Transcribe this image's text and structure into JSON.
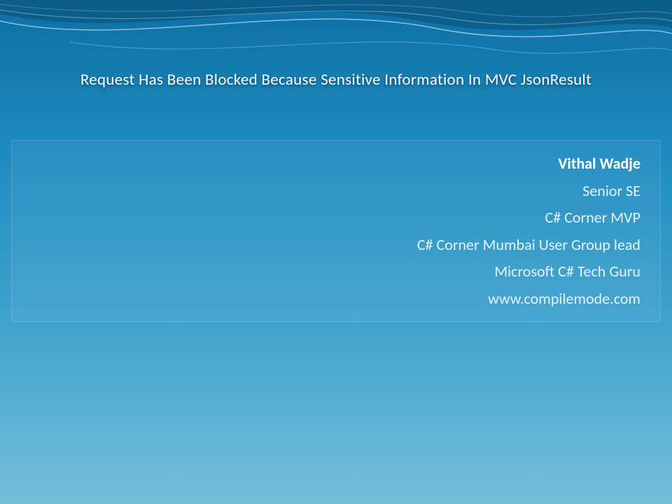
{
  "title": "Request Has Been Blocked Because Sensitive Information In MVC JsonResult",
  "author": {
    "name": "Vithal Wadje",
    "lines": [
      "Senior SE",
      "C# Corner MVP",
      "C# Corner Mumbai User Group lead",
      "Microsoft  C# Tech Guru",
      "www.compilemode.com"
    ]
  }
}
